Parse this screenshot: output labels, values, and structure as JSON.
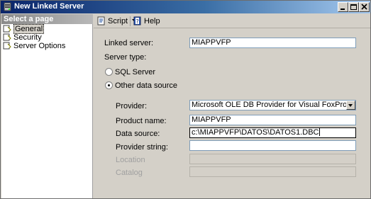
{
  "window": {
    "title": "New Linked Server"
  },
  "leftpane": {
    "header": "Select a page",
    "items": [
      {
        "label": "General",
        "selected": true,
        "icon": "page-icon"
      },
      {
        "label": "Security",
        "selected": false,
        "icon": "page-icon"
      },
      {
        "label": "Server Options",
        "selected": false,
        "icon": "page-icon"
      }
    ]
  },
  "toolbar": {
    "script_label": "Script",
    "help_label": "Help"
  },
  "form": {
    "linked_server_label": "Linked server:",
    "linked_server_value": "MIAPPVFP",
    "server_type_label": "Server type:",
    "sql_server_label": "SQL Server",
    "other_source_label": "Other data source",
    "selected_server_type": "Other data source",
    "provider_label": "Provider:",
    "provider_value": "Microsoft OLE DB Provider for Visual FoxPro",
    "product_name_label": "Product name:",
    "product_name_value": "MIAPPVFP",
    "data_source_label": "Data source:",
    "data_source_value": "c:\\MIAPPVFP\\DATOS\\DATOS1.DBC",
    "provider_string_label": "Provider string:",
    "provider_string_value": "",
    "location_label": "Location",
    "location_value": "",
    "catalog_label": "Catalog",
    "catalog_value": ""
  }
}
